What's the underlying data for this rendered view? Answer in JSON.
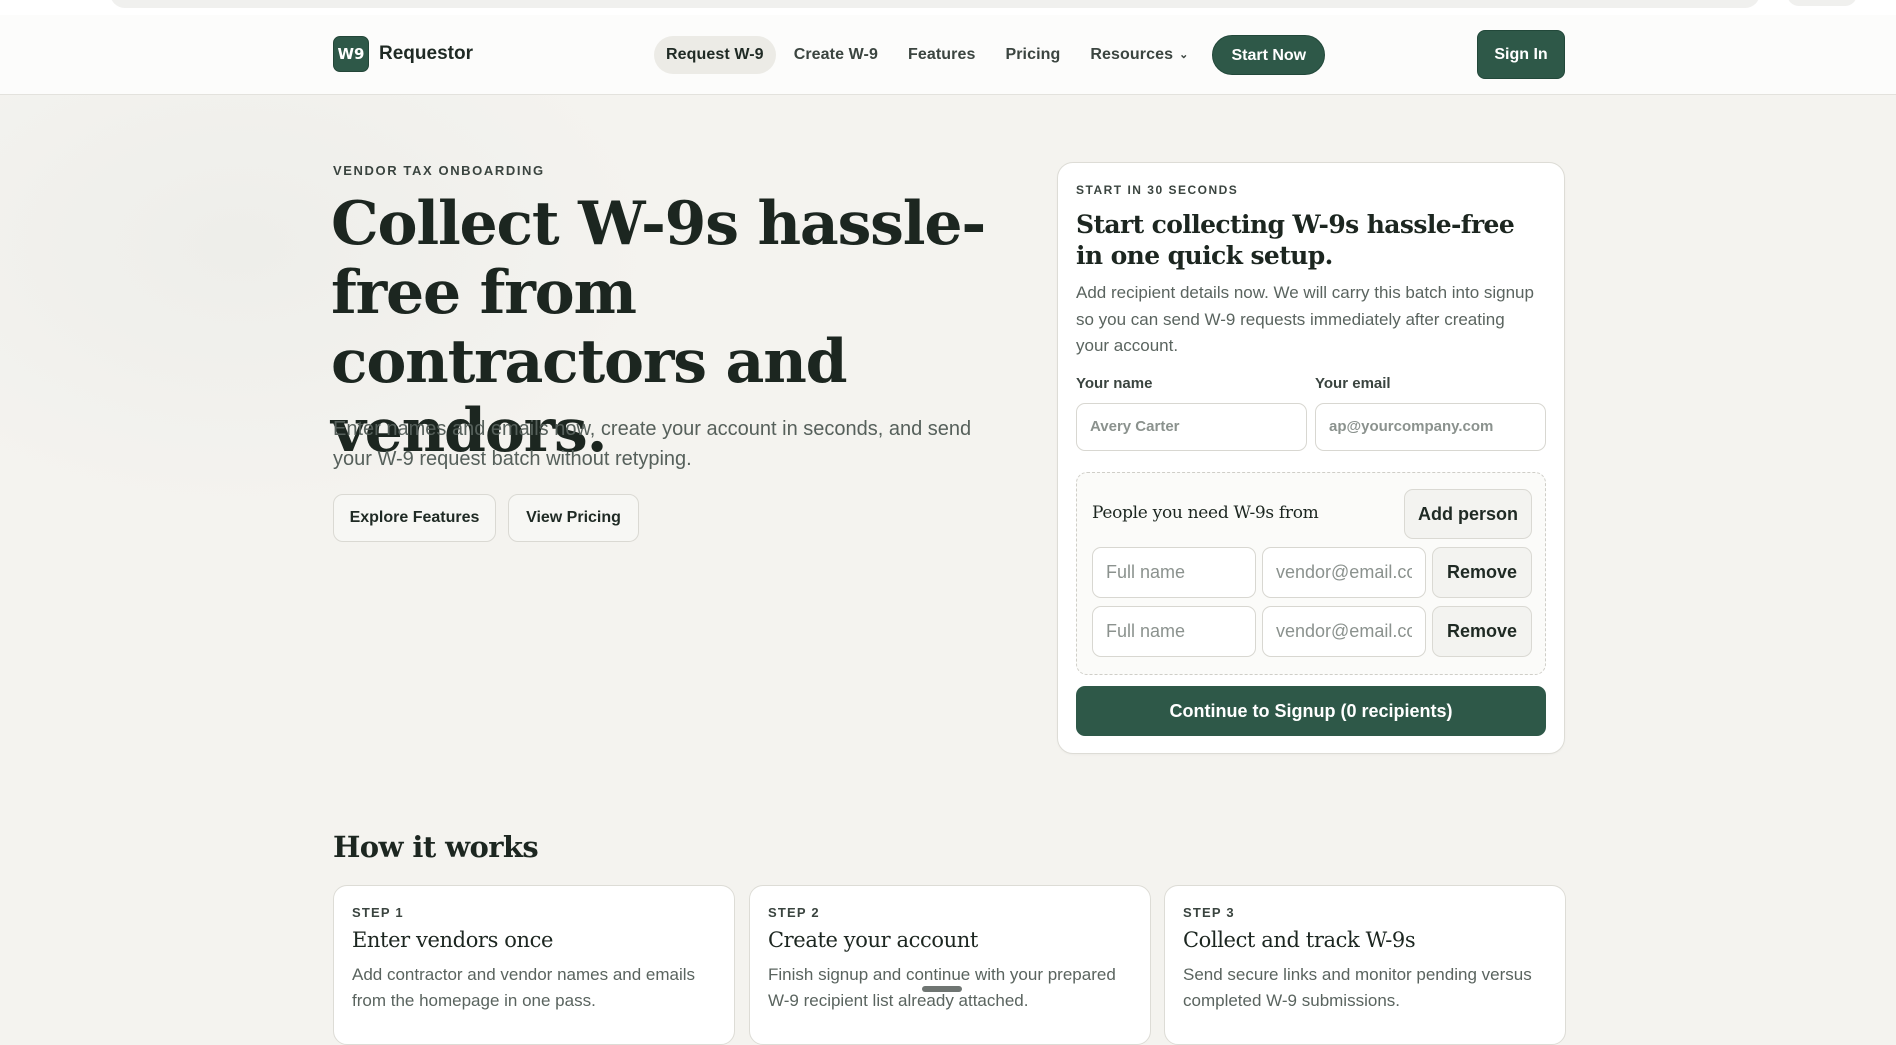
{
  "nav": {
    "logo_text": "W9",
    "brand": "Requestor",
    "links": [
      {
        "label": "Request W-9",
        "active": true
      },
      {
        "label": "Create W-9"
      },
      {
        "label": "Features"
      },
      {
        "label": "Pricing"
      },
      {
        "label": "Resources"
      }
    ],
    "resources_icon": "chevron-down-icon",
    "start_now": "Start Now",
    "sign_in": "Sign In"
  },
  "hero": {
    "eyebrow": "VENDOR TAX ONBOARDING",
    "title": "Collect W-9s hassle-free from contractors and vendors.",
    "subtitle": "Enter names and emails now, create your account in seconds, and send your W-9 request batch without retyping.",
    "explore_features": "Explore Features",
    "view_pricing": "View Pricing"
  },
  "signup_card": {
    "eyebrow": "START IN 30 SECONDS",
    "title": "Start collecting W-9s hassle-free in one quick setup.",
    "description": "Add recipient details now. We will carry this batch into signup so you can send W-9 requests immediately after creating your account.",
    "name_label": "Your name",
    "name_value": "",
    "name_placeholder": "Avery Carter",
    "email_label": "Your email",
    "email_value": "",
    "email_placeholder": "ap@yourcompany.com",
    "people_title": "People you need W-9s from",
    "add_person": "Add person",
    "recipients": [
      {
        "name_placeholder": "Full name",
        "email_placeholder": "vendor@email.com",
        "remove": "Remove"
      },
      {
        "name_placeholder": "Full name",
        "email_placeholder": "vendor@email.com",
        "remove": "Remove"
      }
    ],
    "continue_label": "Continue to Signup (0 recipients)"
  },
  "how_it_works": {
    "title": "How it works",
    "steps": [
      {
        "label": "STEP 1",
        "title": "Enter vendors once",
        "description": "Add contractor and vendor names and emails from the homepage in one pass."
      },
      {
        "label": "STEP 2",
        "title": "Create your account",
        "description": "Finish signup and continue with your prepared W-9 recipient list already attached."
      },
      {
        "label": "STEP 3",
        "title": "Collect and track W-9s",
        "description": "Send secure links and monitor pending versus completed W-9 submissions."
      }
    ]
  },
  "colors": {
    "brand_green": "#2e5848",
    "page_background": "#f4f3ef",
    "text_dark": "#1c2620"
  }
}
